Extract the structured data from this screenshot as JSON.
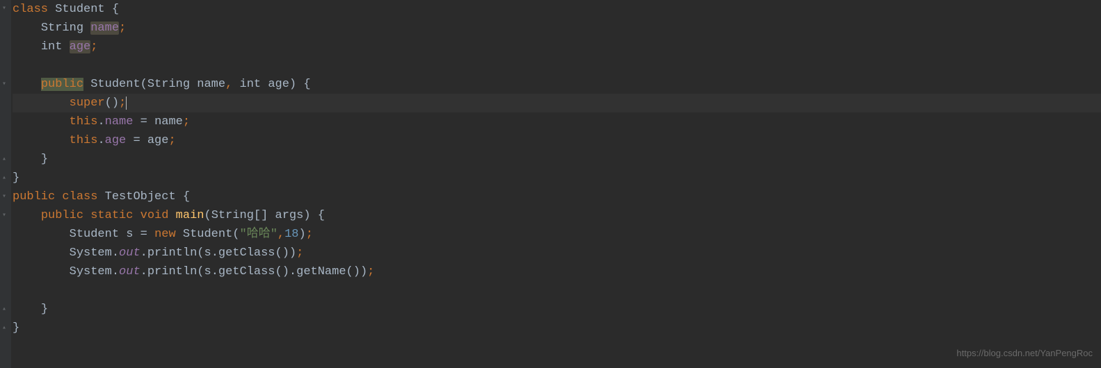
{
  "code": {
    "line1": {
      "kw_class": "class",
      "class_name": "Student",
      "brace": " {"
    },
    "line2": {
      "indent": "    ",
      "type": "String",
      "field": "name",
      "semi": ";"
    },
    "line3": {
      "indent": "    ",
      "type": "int",
      "field": "age",
      "semi": ";"
    },
    "line5": {
      "indent": "    ",
      "kw_public": "public",
      "constructor": "Student",
      "params_open": "(",
      "param1_type": "String",
      "param1_name": "name",
      "comma": ",",
      "param2_type": "int",
      "param2_name": "age",
      "params_close": ")",
      "brace": " {"
    },
    "line6": {
      "indent": "        ",
      "kw_super": "super",
      "call": "()",
      "semi": ";"
    },
    "line7": {
      "indent": "        ",
      "kw_this": "this",
      "dot": ".",
      "field": "name",
      "eq": " = ",
      "param": "name",
      "semi": ";"
    },
    "line8": {
      "indent": "        ",
      "kw_this": "this",
      "dot": ".",
      "field": "age",
      "eq": " = ",
      "param": "age",
      "semi": ";"
    },
    "line9": {
      "indent": "    ",
      "brace": "}"
    },
    "line10": {
      "brace": "}"
    },
    "line11": {
      "kw_public": "public",
      "kw_class": "class",
      "class_name": "TestObject",
      "brace": " {"
    },
    "line12": {
      "indent": "    ",
      "kw_public": "public",
      "kw_static": "static",
      "kw_void": "void",
      "method": "main",
      "params_open": "(",
      "param_type": "String[]",
      "param_name": "args",
      "params_close": ")",
      "brace": " {"
    },
    "line13": {
      "indent": "        ",
      "type": "Student",
      "var": "s",
      "eq": " = ",
      "kw_new": "new",
      "constructor": "Student",
      "paren_open": "(",
      "string": "\"哈哈\"",
      "comma": ",",
      "number": "18",
      "paren_close": ")",
      "semi": ";"
    },
    "line14": {
      "indent": "        ",
      "sys": "System",
      "dot1": ".",
      "out": "out",
      "dot2": ".",
      "println": "println",
      "paren_open": "(",
      "var": "s",
      "dot3": ".",
      "method": "getClass",
      "call": "()",
      "paren_close": ")",
      "semi": ";"
    },
    "line15": {
      "indent": "        ",
      "sys": "System",
      "dot1": ".",
      "out": "out",
      "dot2": ".",
      "println": "println",
      "paren_open": "(",
      "var": "s",
      "dot3": ".",
      "method1": "getClass",
      "call1": "()",
      "dot4": ".",
      "method2": "getName",
      "call2": "()",
      "paren_close": ")",
      "semi": ";"
    },
    "line17": {
      "indent": "    ",
      "brace": "}"
    },
    "line18": {
      "brace": "}"
    }
  },
  "watermark": "https://blog.csdn.net/YanPengRoc"
}
